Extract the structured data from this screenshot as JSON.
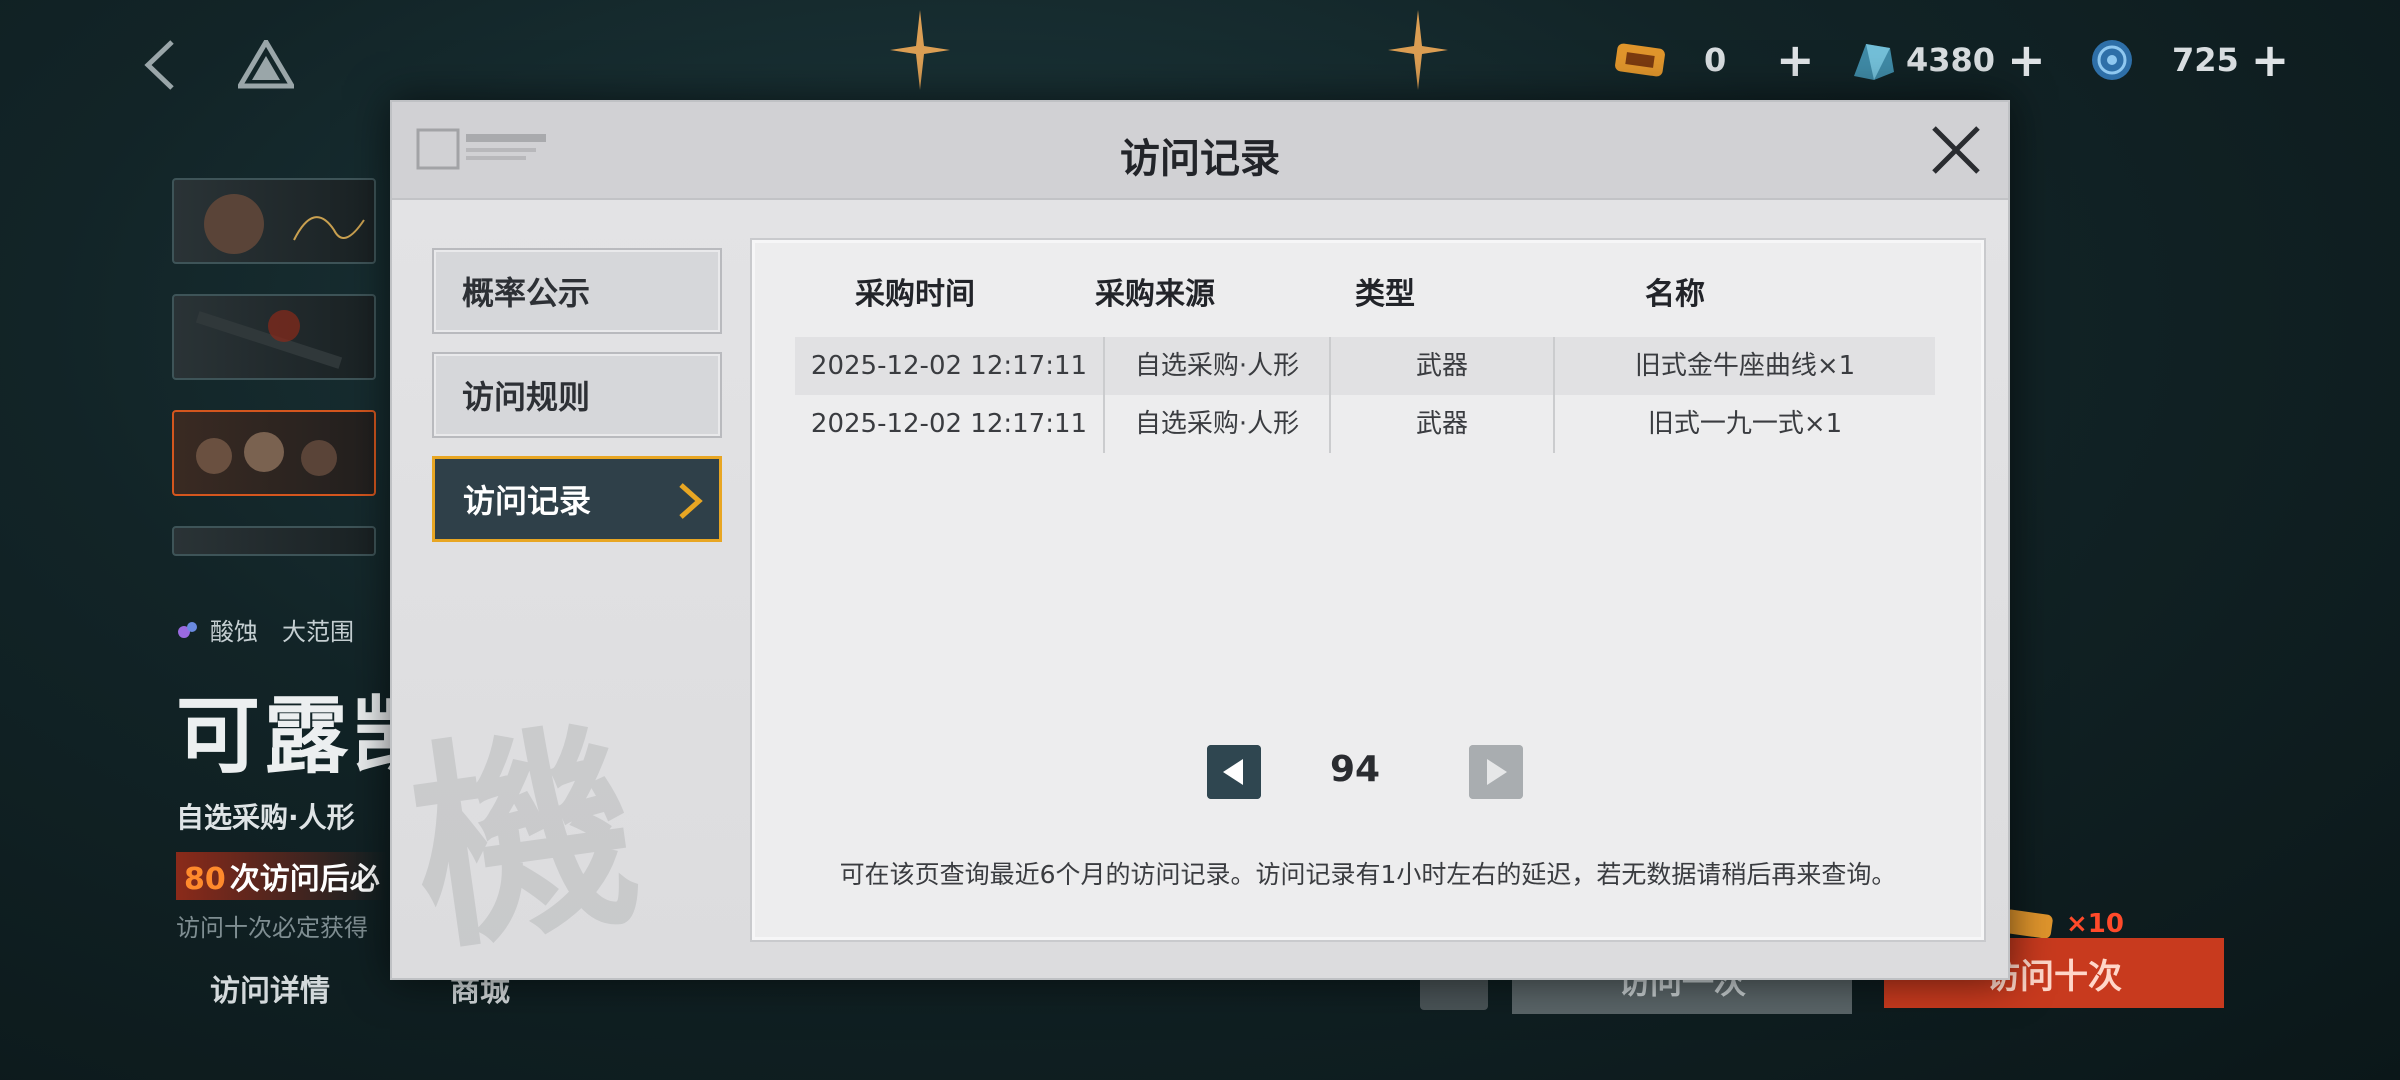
{
  "top_bar": {
    "currencies": [
      {
        "name": "ticket",
        "value": "0",
        "icon": "ticket-icon",
        "color": "#e0952c"
      },
      {
        "name": "crystal",
        "value": "4380",
        "icon": "crystal-icon",
        "color": "#5ab8d8"
      },
      {
        "name": "coin",
        "value": "725",
        "icon": "coin-icon",
        "color": "#3a86c8"
      }
    ],
    "plus_label": "+"
  },
  "background": {
    "tags": [
      "酸蚀",
      "大范围"
    ],
    "character_name": "可露凯",
    "subtitle": "自选采购·人形",
    "guarantee_count": "80",
    "guarantee_text": "次访问后必",
    "note": "访问十次必定获得",
    "bottom_tabs": [
      "访问详情",
      "商城"
    ],
    "action_one": "访问一次",
    "action_ten": "访问十次",
    "ticket_count": "×10"
  },
  "modal": {
    "title": "访问记录",
    "nav": [
      {
        "label": "概率公示",
        "active": false
      },
      {
        "label": "访问规则",
        "active": false
      },
      {
        "label": "访问记录",
        "active": true
      }
    ],
    "table": {
      "headers": [
        "采购时间",
        "采购来源",
        "类型",
        "名称"
      ],
      "rows": [
        [
          "2025-12-02 12:17:11",
          "自选采购·人形",
          "武器",
          "旧式金牛座曲线×1"
        ],
        [
          "2025-12-02 12:17:11",
          "自选采购·人形",
          "武器",
          "旧式一九一式×1"
        ]
      ]
    },
    "page_number": "94",
    "notice": "可在该页查询最近6个月的访问记录。访问记录有1小时左右的延迟，若无数据请稍后再来查询。",
    "accent_color": "#e8a623",
    "active_nav_color": "#2f4049"
  }
}
